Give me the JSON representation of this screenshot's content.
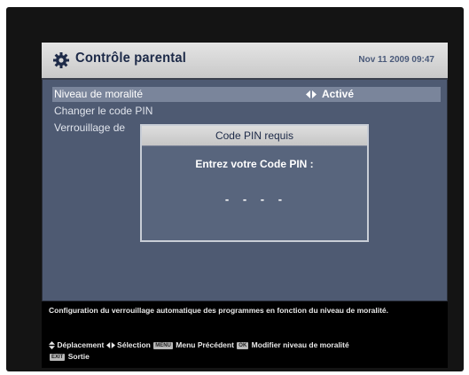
{
  "header": {
    "title": "Contrôle parental",
    "datetime": "Nov 11 2009 09:47",
    "icon": "gear-icon"
  },
  "menu": {
    "items": [
      {
        "label": "Niveau de moralité",
        "value": "Activé",
        "selected": true
      },
      {
        "label": "Changer le code PIN",
        "selected": false
      },
      {
        "label": "Verrouillage de",
        "selected": false
      }
    ]
  },
  "dialog": {
    "title": "Code PIN requis",
    "prompt": "Entrez votre Code PIN :",
    "pin_mask": "- - - -"
  },
  "footer": {
    "description": "Configuration du verrouillage automatique des programmes en fonction du niveau de moralité.",
    "help": {
      "move_label": "Déplacement",
      "select_label": "Sélection",
      "menu_key": "MENU",
      "menu_label": "Menu Précédent",
      "ok_key": "OK",
      "ok_label": "Modifier niveau de moralité",
      "exit_key": "EXIT",
      "exit_label": "Sortie"
    }
  },
  "colors": {
    "panel": "#4e5a72",
    "selected_row": "#7a859b",
    "header_bg": "#d6d6d6",
    "title_text": "#1d2a48"
  }
}
